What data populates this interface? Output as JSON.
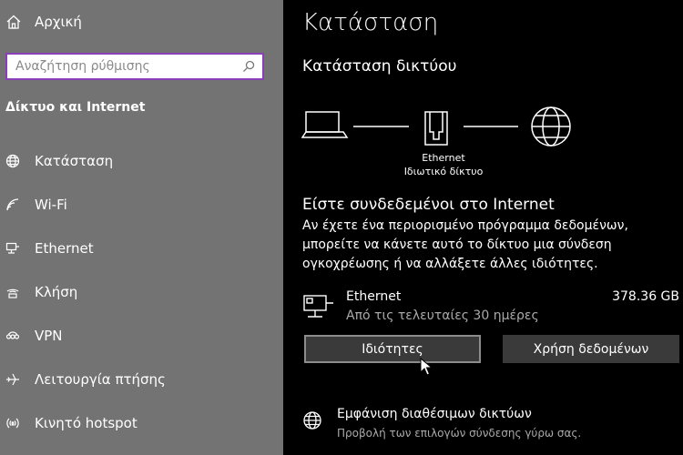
{
  "sidebar": {
    "home_label": "Αρχική",
    "search_placeholder": "Αναζήτηση ρύθμισης",
    "section_title": "Δίκτυο και Internet",
    "items": [
      {
        "label": "Κατάσταση",
        "icon": "globe-icon"
      },
      {
        "label": "Wi-Fi",
        "icon": "wifi-icon"
      },
      {
        "label": "Ethernet",
        "icon": "ethernet-icon"
      },
      {
        "label": "Κλήση",
        "icon": "dialup-icon"
      },
      {
        "label": "VPN",
        "icon": "vpn-icon"
      },
      {
        "label": "Λειτουργία πτήσης",
        "icon": "airplane-icon"
      },
      {
        "label": "Κινητό hotspot",
        "icon": "hotspot-icon"
      }
    ]
  },
  "main": {
    "title": "Κατάσταση",
    "subtitle": "Κατάσταση δικτύου",
    "diagram": {
      "adapter_name": "Ethernet",
      "network_type": "Ιδιωτικό δίκτυο"
    },
    "connected_text": "Είστε συνδεδεμένοι στο Internet",
    "description": "Αν έχετε ένα περιορισμένο πρόγραμμα δεδομένων, μπορείτε να κάνετε αυτό το δίκτυο μια σύνδεση ογκοχρέωσης ή να αλλάξετε άλλες ιδιότητες.",
    "connection": {
      "name": "Ethernet",
      "period": "Από τις τελευταίες 30 ημέρες",
      "usage": "378.36 GB"
    },
    "buttons": {
      "properties": "Ιδιότητες",
      "data_usage": "Χρήση δεδομένων"
    },
    "available_networks": {
      "title": "Εμφάνιση διαθέσιμων δικτύων",
      "subtitle": "Προβολή των επιλογών σύνδεσης γύρω σας."
    }
  },
  "colors": {
    "sidebar_bg": "#737373",
    "main_bg": "#000000",
    "search_border": "#8a3fb8",
    "button_bg": "#3a3a3a"
  }
}
